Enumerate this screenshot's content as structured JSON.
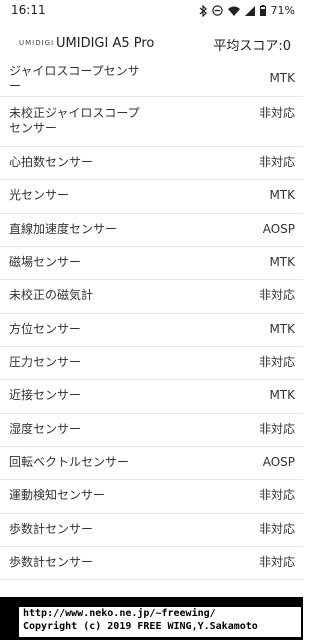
{
  "status_bar": {
    "time": "16:11",
    "battery_percent": "71%",
    "icons": [
      "bluetooth-icon",
      "do-not-disturb-icon",
      "wifi-icon",
      "signal-icon",
      "battery-icon"
    ]
  },
  "header": {
    "brand": "UMIDIGI",
    "device": "UMIDIGI A5 Pro",
    "score": "平均スコア:0"
  },
  "sensors": [
    {
      "name": "ジャイロスコープセンサー",
      "value": "MTK"
    },
    {
      "name": "未校正ジャイロスコープセンサー",
      "value": "非対応"
    },
    {
      "name": "心拍数センサー",
      "value": "非対応"
    },
    {
      "name": "光センサー",
      "value": "MTK"
    },
    {
      "name": "直線加速度センサー",
      "value": "AOSP"
    },
    {
      "name": "磁場センサー",
      "value": "MTK"
    },
    {
      "name": "未校正の磁気計",
      "value": "非対応"
    },
    {
      "name": "方位センサー",
      "value": "MTK"
    },
    {
      "name": "圧力センサー",
      "value": "非対応"
    },
    {
      "name": "近接センサー",
      "value": "MTK"
    },
    {
      "name": "湿度センサー",
      "value": "非対応"
    },
    {
      "name": "回転ベクトルセンサー",
      "value": "AOSP"
    },
    {
      "name": "運動検知センサー",
      "value": "非対応"
    },
    {
      "name": "歩数計センサー",
      "value": "非対応"
    },
    {
      "name": "歩数計センサー",
      "value": "非対応"
    }
  ],
  "footer": {
    "url": "http://www.neko.ne.jp/~freewing/",
    "copyright": "Copyright (c) 2019 FREE WING,Y.Sakamoto"
  }
}
